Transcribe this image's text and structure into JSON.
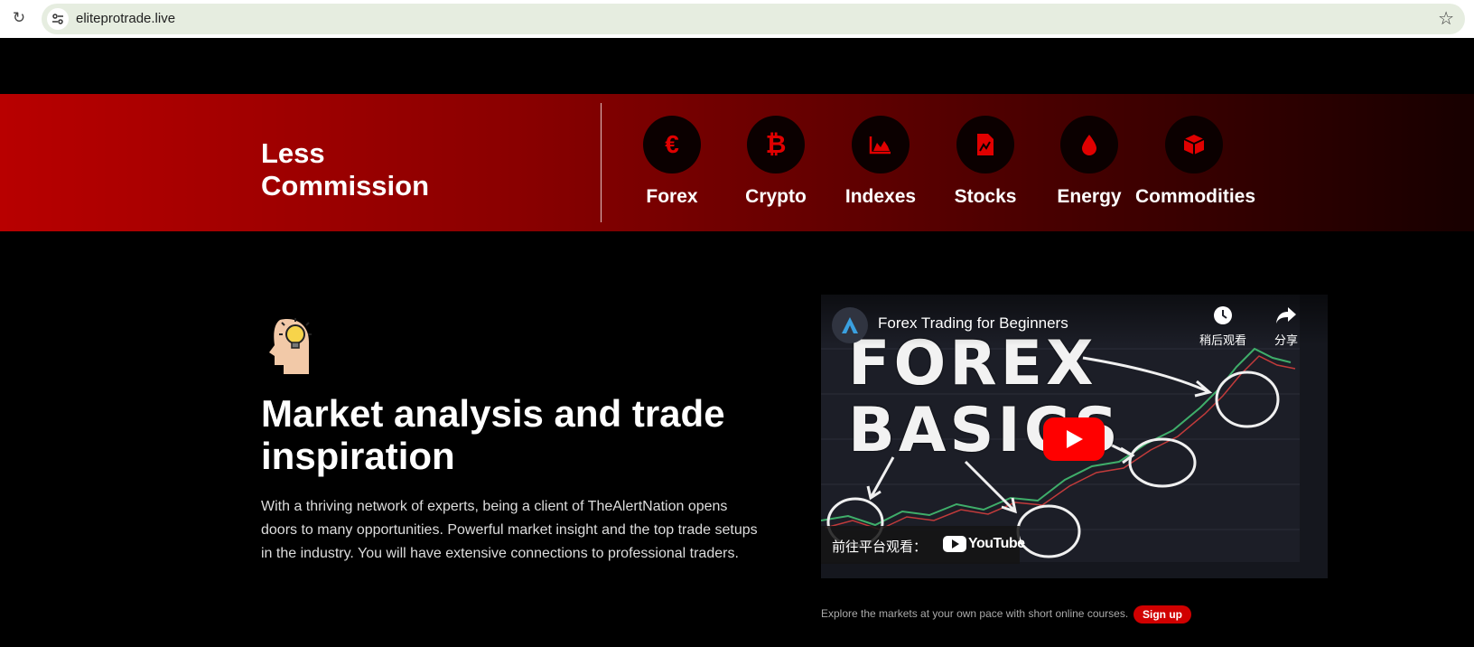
{
  "browser": {
    "url": "eliteprotrade.live",
    "reload_icon": "reload-icon",
    "star_icon": "bookmark-star-icon"
  },
  "banner": {
    "title": "Less Commission",
    "markets": [
      {
        "label": "Forex",
        "icon": "euro-icon"
      },
      {
        "label": "Crypto",
        "icon": "bitcoin-icon"
      },
      {
        "label": "Indexes",
        "icon": "area-chart-icon"
      },
      {
        "label": "Stocks",
        "icon": "document-chart-icon"
      },
      {
        "label": "Energy",
        "icon": "drop-icon"
      },
      {
        "label": "Commodities",
        "icon": "box-icon"
      }
    ]
  },
  "feature": {
    "icon": "head-lightbulb-icon",
    "title": "Market analysis and trade inspiration",
    "text": "With a thriving network of experts, being a client of TheAlertNation opens doors to many opportunities. Powerful market insight and the top trade setups in the industry. You will have extensive connections to professional traders."
  },
  "video": {
    "title": "Forex Trading for Beginners",
    "watch_later": "稍后观看",
    "share": "分享",
    "thumbnail_line1": "FOREX",
    "thumbnail_line2": "BASICS",
    "watch_on": "前往平台观看：",
    "platform": "YouTube"
  },
  "courses": {
    "text": "Explore the markets at your own pace with short online courses.",
    "signup_label": "Sign up"
  },
  "colors": {
    "accent": "#d00000",
    "banner_start": "#b80000",
    "banner_end": "#170000"
  }
}
